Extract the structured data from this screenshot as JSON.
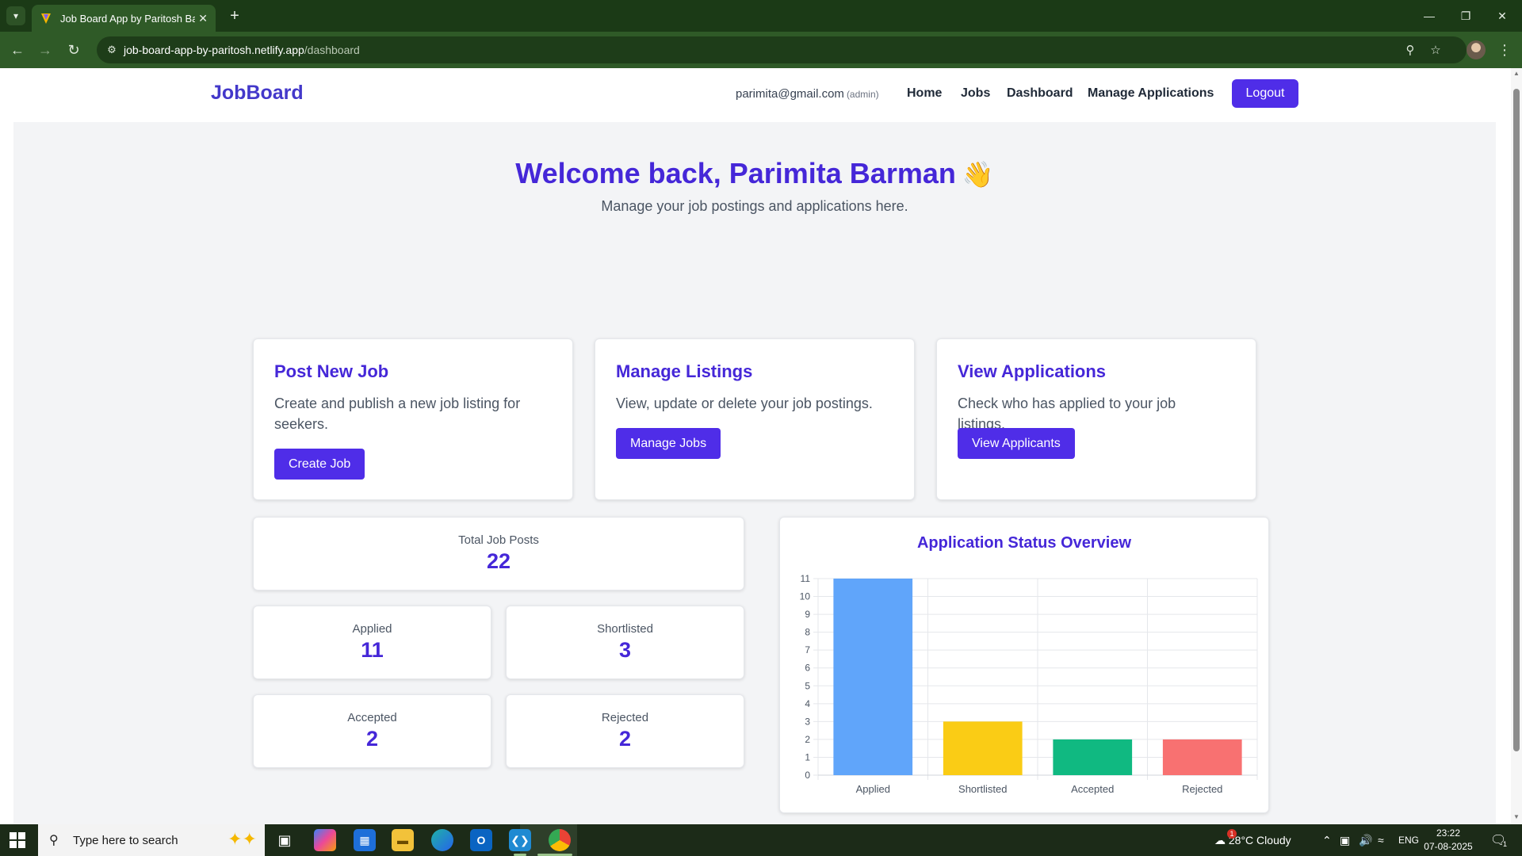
{
  "browser": {
    "tab_title": "Job Board App by Paritosh Barman",
    "url_host": "job-board-app-by-paritosh.netlify.app",
    "url_path": "/dashboard"
  },
  "nav": {
    "brand": "JobBoard",
    "user_email": "parimita@gmail.com",
    "user_role": "(admin)",
    "links": [
      "Home",
      "Jobs",
      "Dashboard",
      "Manage Applications"
    ],
    "logout": "Logout"
  },
  "hero": {
    "welcome": "Welcome back, Parimita Barman",
    "wave": "👋",
    "subtitle": "Manage your job postings and applications here."
  },
  "cards": [
    {
      "title": "Post New Job",
      "description": "Create and publish a new job listing for seekers.",
      "button": "Create Job"
    },
    {
      "title": "Manage Listings",
      "description": "View, update or delete your job postings.",
      "button": "Manage Jobs"
    },
    {
      "title": "View Applications",
      "description": "Check who has applied to your job listings.",
      "button": "View Applicants"
    }
  ],
  "stats": {
    "total_label": "Total Job Posts",
    "total_value": "22",
    "applied_label": "Applied",
    "applied_value": "11",
    "shortlisted_label": "Shortlisted",
    "shortlisted_value": "3",
    "accepted_label": "Accepted",
    "accepted_value": "2",
    "rejected_label": "Rejected",
    "rejected_value": "2"
  },
  "chart_data": {
    "type": "bar",
    "title": "Application Status Overview",
    "categories": [
      "Applied",
      "Shortlisted",
      "Accepted",
      "Rejected"
    ],
    "values": [
      11,
      3,
      2,
      2
    ],
    "colors": [
      "#60a5fa",
      "#facc15",
      "#10b981",
      "#f87171"
    ],
    "ylim": [
      0,
      11
    ],
    "yticks": [
      0,
      1,
      2,
      3,
      4,
      5,
      6,
      7,
      8,
      9,
      10,
      11
    ],
    "grid": true,
    "legend": "none"
  },
  "taskbar": {
    "search_placeholder": "Type here to search",
    "weather": "28°C  Cloudy",
    "weather_badge": "1",
    "language": "ENG",
    "time": "23:22",
    "date": "07-08-2025",
    "notification_count": "1"
  }
}
